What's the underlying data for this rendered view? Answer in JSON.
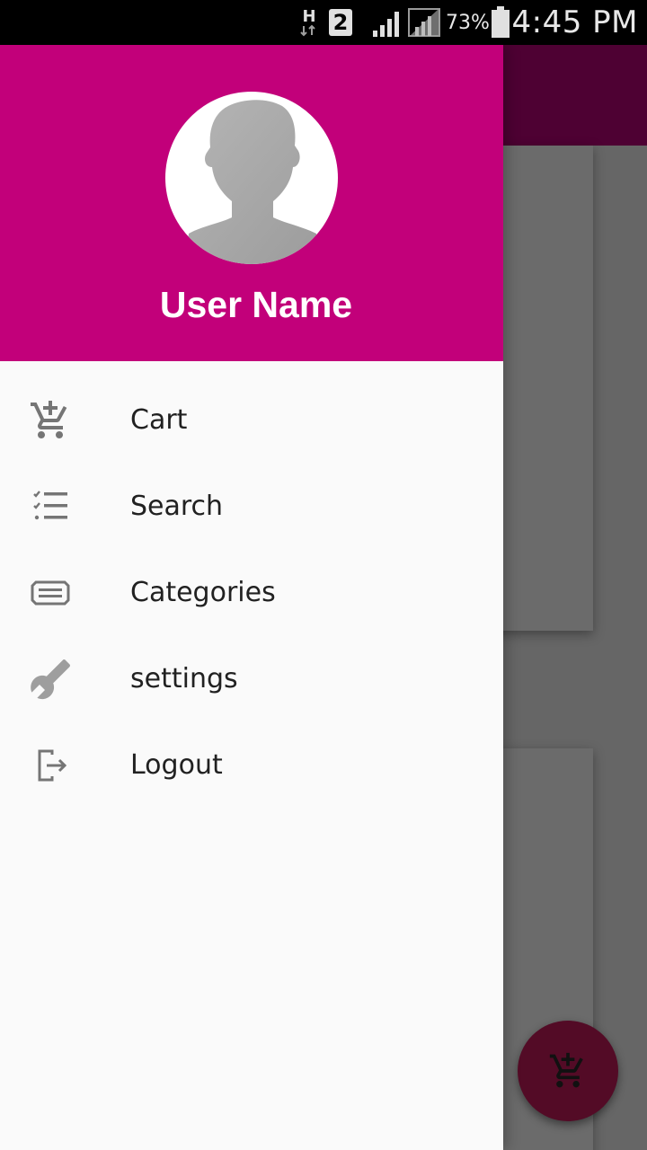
{
  "status_bar": {
    "network_type": "H",
    "sim_slot": "2",
    "battery_percent": "73%",
    "time": "4:45 PM"
  },
  "drawer": {
    "user_name": "User Name",
    "items": [
      {
        "label": "Cart",
        "icon": "cart-icon"
      },
      {
        "label": "Search",
        "icon": "checklist-icon"
      },
      {
        "label": "Categories",
        "icon": "categories-icon"
      },
      {
        "label": "settings",
        "icon": "wrench-icon"
      },
      {
        "label": "Logout",
        "icon": "logout-icon"
      }
    ]
  },
  "fab": {
    "icon": "add-to-cart-icon"
  },
  "colors": {
    "drawer_header": "#c2007a",
    "toolbar_dimmed": "#4e0133",
    "fab_dimmed": "#530b26",
    "scrim_background": "#666666",
    "drawer_background": "#fafafa"
  }
}
